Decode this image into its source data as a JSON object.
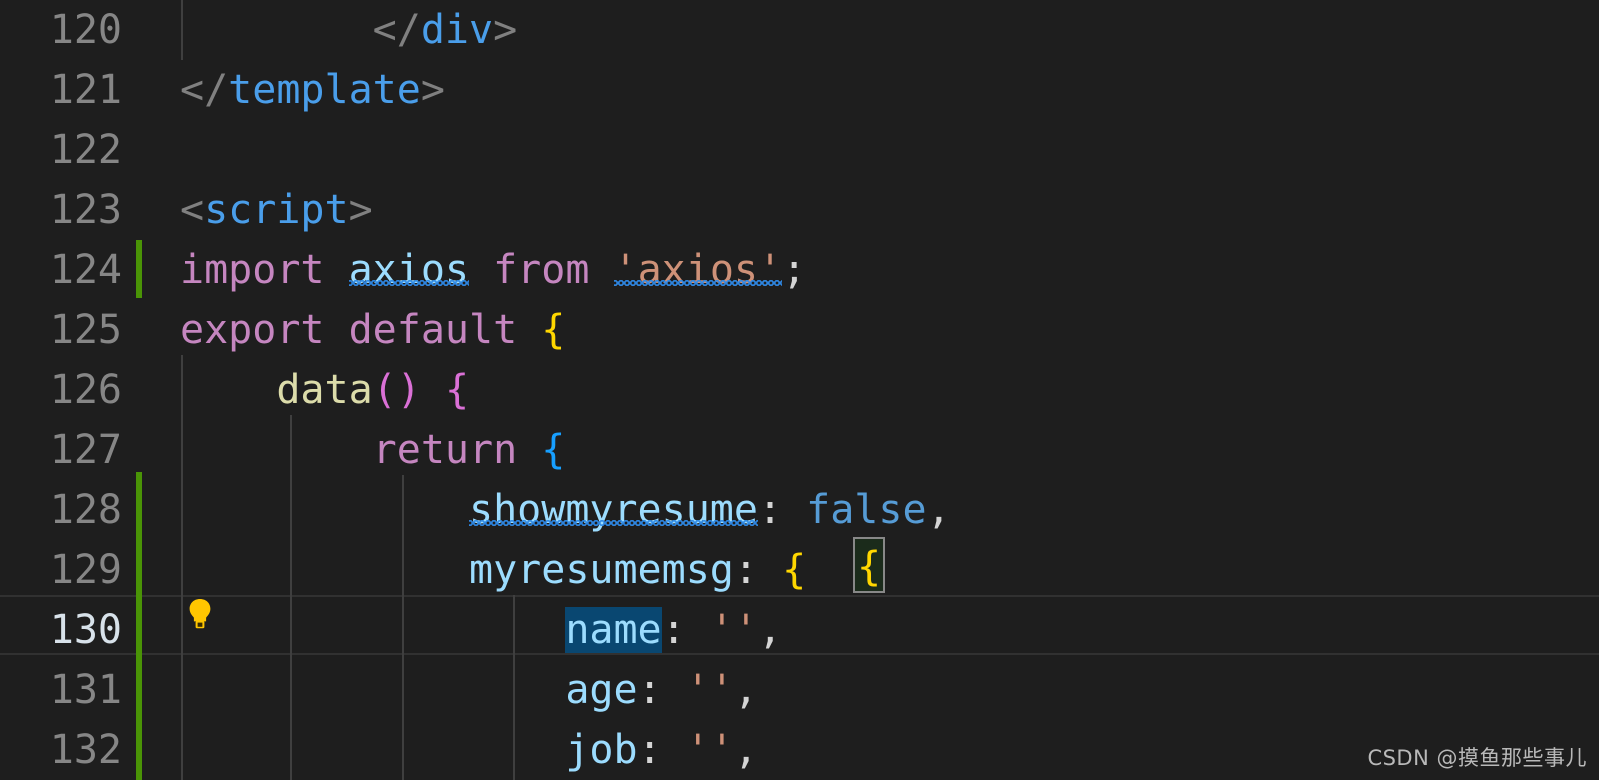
{
  "editor": {
    "theme_background": "#1e1e1e",
    "active_line_number": 130,
    "line_number_color": "#868686",
    "active_line_number_color": "#d8e2ea",
    "modified_gutter_color": "#4a9406",
    "selection_color": "#094771",
    "selected_text": "name",
    "lines": [
      {
        "number": "120",
        "text": "        </div>"
      },
      {
        "number": "121",
        "text": "</template>"
      },
      {
        "number": "122",
        "text": ""
      },
      {
        "number": "123",
        "text": "<script>"
      },
      {
        "number": "124",
        "text": "import axios from 'axios';",
        "modified": true
      },
      {
        "number": "125",
        "text": "export default {"
      },
      {
        "number": "126",
        "text": "    data() {"
      },
      {
        "number": "127",
        "text": "        return {"
      },
      {
        "number": "128",
        "text": "            showmyresume: false,",
        "modified": true
      },
      {
        "number": "129",
        "text": "            myresumemsg: {",
        "modified": true
      },
      {
        "number": "130",
        "text": "                name: '',",
        "modified": true,
        "active": true
      },
      {
        "number": "131",
        "text": "                age: '',",
        "modified": true
      },
      {
        "number": "132",
        "text": "                job: '',",
        "modified": true
      }
    ],
    "diagnostics": [
      {
        "line": 124,
        "word": "axios",
        "kind": "spelling-squiggle"
      },
      {
        "line": 124,
        "word": "axios-string",
        "kind": "spelling-squiggle"
      },
      {
        "line": 128,
        "word": "showmyresume",
        "kind": "spelling-squiggle"
      }
    ],
    "bracket_match": {
      "line": 129,
      "character": "{"
    },
    "quick_fix": {
      "line": 130,
      "icon": "lightbulb-icon",
      "color": "#ffc600"
    }
  },
  "tokens": {
    "l120": [
      {
        "t": "        ",
        "c": "t-punct"
      },
      {
        "t": "</",
        "c": "t-tagpunct"
      },
      {
        "t": "div",
        "c": "t-tag"
      },
      {
        "t": ">",
        "c": "t-tagpunct"
      }
    ],
    "l121": [
      {
        "t": "</",
        "c": "t-tagpunct"
      },
      {
        "t": "template",
        "c": "t-tag"
      },
      {
        "t": ">",
        "c": "t-tagpunct"
      }
    ],
    "l123": [
      {
        "t": "<",
        "c": "t-tagpunct"
      },
      {
        "t": "script",
        "c": "t-tag"
      },
      {
        "t": ">",
        "c": "t-tagpunct"
      }
    ],
    "l124": [
      {
        "t": "import ",
        "c": "t-kw"
      },
      {
        "t": "axios",
        "c": "t-var",
        "squiggle": true
      },
      {
        "t": " from ",
        "c": "t-kw"
      },
      {
        "t": "'axios'",
        "c": "t-str",
        "squiggle": true
      },
      {
        "t": ";",
        "c": "t-punct"
      }
    ],
    "l125": [
      {
        "t": "export default ",
        "c": "t-kw"
      },
      {
        "t": "{",
        "c": "t-br1"
      }
    ],
    "l126": [
      {
        "t": "    ",
        "c": "t-punct"
      },
      {
        "t": "data",
        "c": "t-fn"
      },
      {
        "t": "(",
        "c": "t-br2"
      },
      {
        "t": ")",
        "c": "t-br2"
      },
      {
        "t": " ",
        "c": "t-punct"
      },
      {
        "t": "{",
        "c": "t-br2"
      }
    ],
    "l127": [
      {
        "t": "        ",
        "c": "t-punct"
      },
      {
        "t": "return",
        "c": "t-kw"
      },
      {
        "t": " ",
        "c": "t-punct"
      },
      {
        "t": "{",
        "c": "t-br3"
      }
    ],
    "l128": [
      {
        "t": "            ",
        "c": "t-punct"
      },
      {
        "t": "showmyresume",
        "c": "t-prop",
        "squiggle": true
      },
      {
        "t": ": ",
        "c": "t-punct"
      },
      {
        "t": "false",
        "c": "t-const"
      },
      {
        "t": ",",
        "c": "t-punct"
      }
    ],
    "l129": [
      {
        "t": "            ",
        "c": "t-punct"
      },
      {
        "t": "myresumemsg",
        "c": "t-prop"
      },
      {
        "t": ": ",
        "c": "t-punct"
      },
      {
        "t": "{",
        "c": "t-br1"
      }
    ],
    "l130": [
      {
        "t": "                ",
        "c": "t-punct"
      },
      {
        "t": "name",
        "c": "t-prop",
        "selected": true
      },
      {
        "t": ": ",
        "c": "t-punct"
      },
      {
        "t": "''",
        "c": "t-str"
      },
      {
        "t": ",",
        "c": "t-punct"
      }
    ],
    "l131": [
      {
        "t": "                ",
        "c": "t-punct"
      },
      {
        "t": "age",
        "c": "t-prop"
      },
      {
        "t": ": ",
        "c": "t-punct"
      },
      {
        "t": "''",
        "c": "t-str"
      },
      {
        "t": ",",
        "c": "t-punct"
      }
    ],
    "l132": [
      {
        "t": "                ",
        "c": "t-punct"
      },
      {
        "t": "job",
        "c": "t-prop"
      },
      {
        "t": ": ",
        "c": "t-punct"
      },
      {
        "t": "''",
        "c": "t-str"
      },
      {
        "t": ",",
        "c": "t-punct"
      }
    ]
  },
  "watermark": {
    "text": "CSDN @摸鱼那些事儿"
  }
}
